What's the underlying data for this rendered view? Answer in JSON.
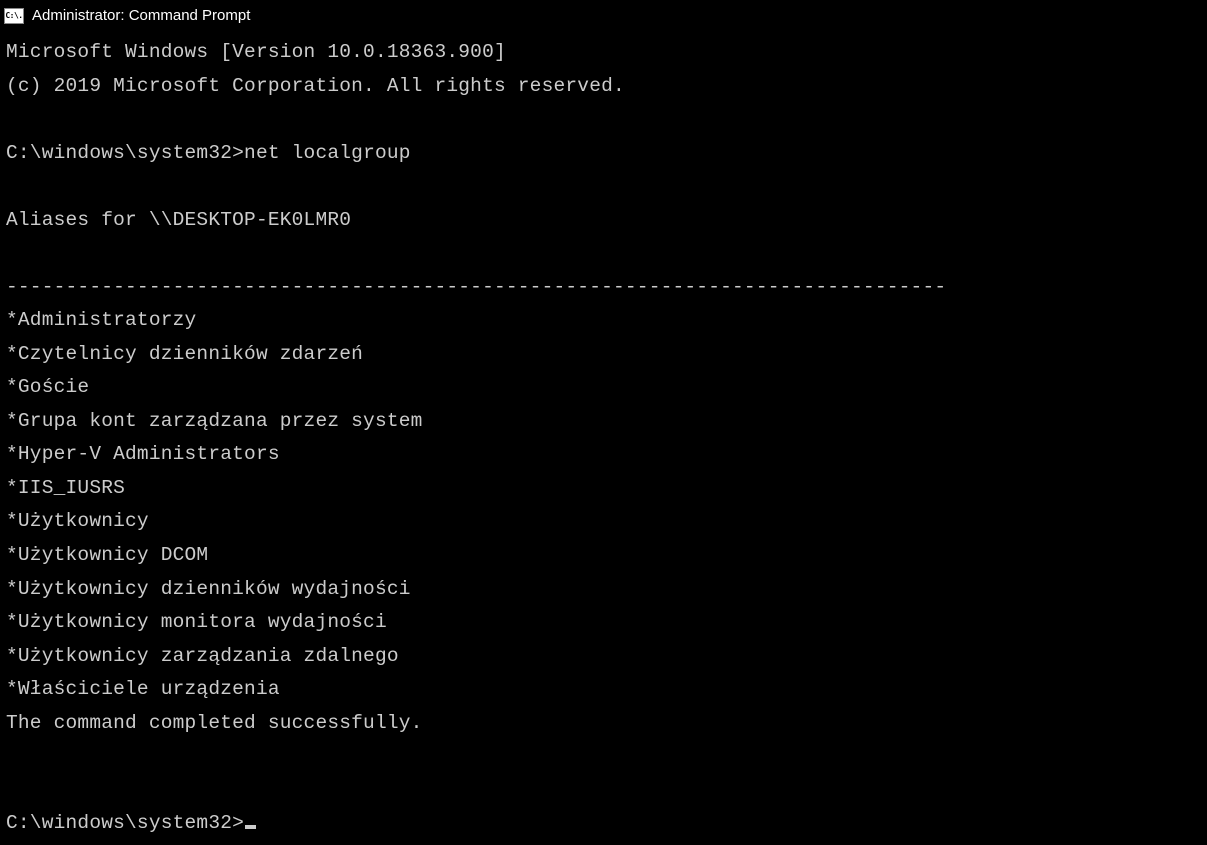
{
  "titlebar": {
    "icon_text": "C:\\.",
    "title": "Administrator: Command Prompt"
  },
  "terminal": {
    "banner_line1": "Microsoft Windows [Version 10.0.18363.900]",
    "banner_line2": "(c) 2019 Microsoft Corporation. All rights reserved.",
    "prompt1_path": "C:\\windows\\system32>",
    "prompt1_command": "net localgroup",
    "aliases_header": "Aliases for \\\\DESKTOP-EK0LMR0",
    "separator": "-------------------------------------------------------------------------------",
    "groups": [
      "*Administratorzy",
      "*Czytelnicy dzienników zdarzeń",
      "*Goście",
      "*Grupa kont zarządzana przez system",
      "*Hyper-V Administrators",
      "*IIS_IUSRS",
      "*Użytkownicy",
      "*Użytkownicy DCOM",
      "*Użytkownicy dzienników wydajności",
      "*Użytkownicy monitora wydajności",
      "*Użytkownicy zarządzania zdalnego",
      "*Właściciele urządzenia"
    ],
    "completion_message": "The command completed successfully.",
    "prompt2_path": "C:\\windows\\system32>"
  }
}
